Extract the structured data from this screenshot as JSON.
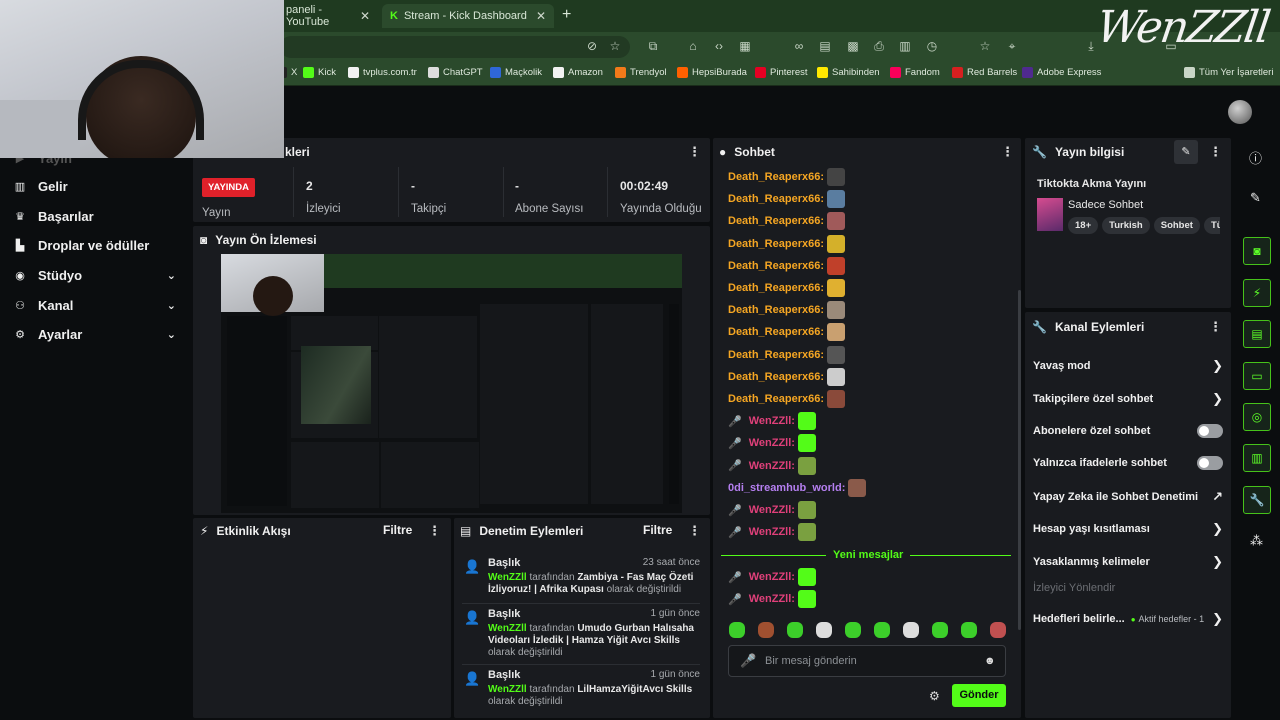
{
  "browser": {
    "tabs": [
      {
        "label": "paneli - YouTube"
      },
      {
        "label": "Stream - Kick Dashboard"
      }
    ],
    "bookmarks": [
      {
        "label": "X",
        "color": "#222222"
      },
      {
        "label": "Kick",
        "color": "#53fc18"
      },
      {
        "label": "tvplus.com.tr",
        "color": "#f2f2f2"
      },
      {
        "label": "ChatGPT",
        "color": "#dddddd"
      },
      {
        "label": "Maçkolik",
        "color": "#2f67d8"
      },
      {
        "label": "Amazon",
        "color": "#f2f2f2"
      },
      {
        "label": "Trendyol",
        "color": "#f27a1a"
      },
      {
        "label": "HepsiBurada",
        "color": "#ff6000"
      },
      {
        "label": "Pinterest",
        "color": "#e60023"
      },
      {
        "label": "Sahibinden",
        "color": "#ffe800"
      },
      {
        "label": "Fandom",
        "color": "#fa005a"
      },
      {
        "label": "Red Barrels",
        "color": "#d62020"
      },
      {
        "label": "Adobe Express",
        "color": "#4f2a8f"
      },
      {
        "label": "Tüm Yer İşaretleri",
        "color": "#c9d6c7"
      }
    ],
    "logo": "WenZZll"
  },
  "sidebar": {
    "items": [
      {
        "label": "Yayın",
        "icon": "video-icon"
      },
      {
        "label": "Gelir",
        "icon": "money-icon"
      },
      {
        "label": "Başarılar",
        "icon": "trophy-icon"
      },
      {
        "label": "Droplar ve ödüller",
        "icon": "gift-icon"
      },
      {
        "label": "Stüdyo",
        "icon": "studio-icon"
      },
      {
        "label": "Kanal",
        "icon": "channel-icon"
      },
      {
        "label": "Ayarlar",
        "icon": "gear-icon"
      }
    ]
  },
  "stats": {
    "title": "kleri",
    "live_badge": "YAYINDA",
    "items": [
      {
        "value": "",
        "label": "Yayın"
      },
      {
        "value": "2",
        "label": "İzleyici"
      },
      {
        "value": "-",
        "label": "Takipçi"
      },
      {
        "value": "-",
        "label": "Abone Sayısı"
      },
      {
        "value": "00:02:49",
        "label": "Yayında Olduğu"
      }
    ]
  },
  "preview": {
    "title": "Yayın Ön İzlemesi"
  },
  "activity": {
    "title": "Etkinlik Akışı",
    "filter": "Filtre"
  },
  "moderation": {
    "title": "Denetim Eylemleri",
    "filter": "Filtre",
    "events": [
      {
        "title": "Başlık",
        "time": "23 saat önce",
        "user": "WenZZll",
        "by": "tarafından",
        "text": "Zambiya - Fas Maç Özeti İzliyoruz! | Afrika Kupası",
        "suffix": "olarak değiştirildi"
      },
      {
        "title": "Başlık",
        "time": "1 gün önce",
        "user": "WenZZll",
        "by": "tarafından",
        "text": "Umudo Gurban Halısaha Videoları İzledik | Hamza Yiğit Avcı Skills",
        "suffix": "olarak değiştirildi"
      },
      {
        "title": "Başlık",
        "time": "1 gün önce",
        "user": "WenZZll",
        "by": "tarafından",
        "text": "LilHamzaYiğitAvcı Skills",
        "suffix": "olarak değiştirildi"
      }
    ]
  },
  "chat": {
    "title": "Sohbet",
    "messages": [
      {
        "user": "Death_Reaperx66:",
        "color": "#f5a623",
        "emote": "#444444"
      },
      {
        "user": "Death_Reaperx66:",
        "color": "#f5a623",
        "emote": "#5a7da0"
      },
      {
        "user": "Death_Reaperx66:",
        "color": "#f5a623",
        "emote": "#a05a5a"
      },
      {
        "user": "Death_Reaperx66:",
        "color": "#f5a623",
        "emote": "#d4b02a"
      },
      {
        "user": "Death_Reaperx66:",
        "color": "#f5a623",
        "emote": "#c0402a"
      },
      {
        "user": "Death_Reaperx66:",
        "color": "#f5a623",
        "emote": "#e0b030"
      },
      {
        "user": "Death_Reaperx66:",
        "color": "#f5a623",
        "emote": "#9a8a7a"
      },
      {
        "user": "Death_Reaperx66:",
        "color": "#f5a623",
        "emote": "#c9a070"
      },
      {
        "user": "Death_Reaperx66:",
        "color": "#f5a623",
        "emote": "#555555"
      },
      {
        "user": "Death_Reaperx66:",
        "color": "#f5a623",
        "emote": "#cccccc"
      },
      {
        "user": "Death_Reaperx66:",
        "color": "#f5a623",
        "emote": "#8a4a3a"
      },
      {
        "user": "WenZZll:",
        "color": "#e0407a",
        "emote": "#53fc18",
        "mic": true
      },
      {
        "user": "WenZZll:",
        "color": "#e0407a",
        "emote": "#53fc18",
        "mic": true
      },
      {
        "user": "WenZZll:",
        "color": "#e0407a",
        "emote": "#7aa040",
        "mic": true
      },
      {
        "user": "0di_streamhub_world:",
        "color": "#b57ff0",
        "emote": "#8a5a4a"
      },
      {
        "user": "WenZZll:",
        "color": "#e0407a",
        "emote": "#7aa040",
        "mic": true
      },
      {
        "user": "WenZZll:",
        "color": "#e0407a",
        "emote": "#7aa040",
        "mic": true
      }
    ],
    "new_messages": "Yeni mesajlar",
    "new": [
      {
        "user": "WenZZll:",
        "color": "#e0407a",
        "emote": "#53fc18",
        "mic": true
      },
      {
        "user": "WenZZll:",
        "color": "#e0407a",
        "emote": "#53fc18",
        "mic": true
      }
    ],
    "emotes": [
      "#3ccf2a",
      "#a05030",
      "#3ccf2a",
      "#dddddd",
      "#3ccf2a",
      "#3ccf2a",
      "#dddddd",
      "#3ccf2a",
      "#3ccf2a",
      "#c05050"
    ],
    "placeholder": "Bir mesaj gönderin",
    "send": "Gönder"
  },
  "streaminfo": {
    "title": "Yayın bilgisi",
    "stream_title": "Tiktokta Akma Yayını",
    "category": "Sadece Sohbet",
    "tags": [
      "18+",
      "Turkish",
      "Sohbet",
      "Tür"
    ]
  },
  "channel": {
    "title": "Kanal Eylemleri",
    "actions": [
      {
        "label": "Yavaş mod",
        "kind": "chevron"
      },
      {
        "label": "Takipçilere özel sohbet",
        "kind": "chevron"
      },
      {
        "label": "Abonelere özel sohbet",
        "kind": "toggle"
      },
      {
        "label": "Yalnızca ifadelerle sohbet",
        "kind": "toggle"
      },
      {
        "label": "Yapay Zeka ile Sohbet Denetimi",
        "kind": "external"
      },
      {
        "label": "Hesap yaşı kısıtlaması",
        "kind": "chevron"
      },
      {
        "label": "Yasaklanmış kelimeler",
        "kind": "chevron"
      },
      {
        "label": "İzleyici Yönlendir",
        "kind": "disabled"
      },
      {
        "label": "Hedefleri belirle...",
        "kind": "goals",
        "extra": "Aktif hedefler - 1"
      }
    ]
  },
  "rail": [
    "info-icon",
    "edit-icon",
    "camera-icon",
    "bolt-icon",
    "notes-icon",
    "chat-icon",
    "broadcast-icon",
    "layout-icon",
    "wrench-icon",
    "share-icon"
  ]
}
